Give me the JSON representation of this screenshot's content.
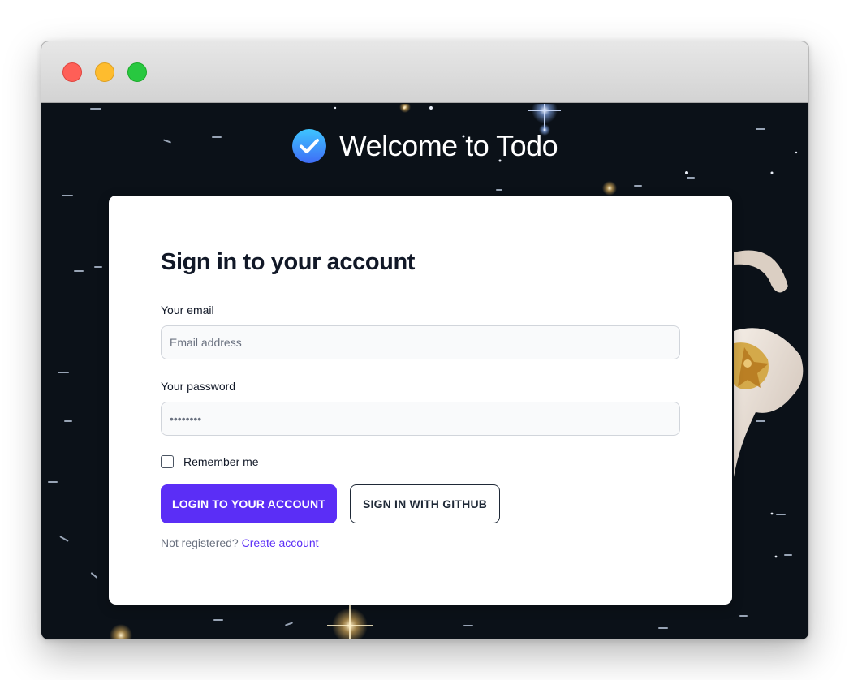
{
  "window": {
    "controls": [
      "close",
      "minimize",
      "zoom"
    ]
  },
  "header": {
    "icon": "check-circle-icon",
    "title": "Welcome to Todo"
  },
  "form": {
    "title": "Sign in to your account",
    "email_label": "Your email",
    "email_placeholder": "Email address",
    "email_value": "",
    "password_label": "Your password",
    "password_value": "••••••••",
    "remember_label": "Remember me",
    "remember_checked": false,
    "login_button": "LOGIN TO YOUR ACCOUNT",
    "github_button": "SIGN IN WITH GITHUB",
    "register_prompt": "Not registered?",
    "register_link": "Create account"
  },
  "colors": {
    "primary": "#5b2ef6",
    "card": "#ffffff",
    "background": "#0b1118"
  }
}
